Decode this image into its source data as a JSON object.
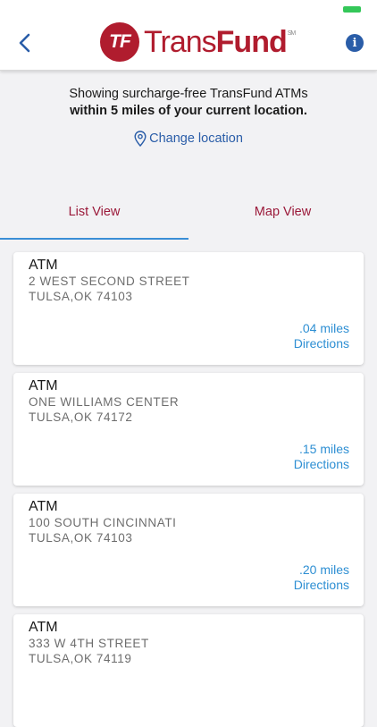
{
  "colors": {
    "brand": "#b01c2e",
    "link": "#2a5da8",
    "accent_blue": "#2e8fd3",
    "tab_text": "#9b1a3a",
    "battery": "#34c759",
    "gray_text": "#8a8a8a"
  },
  "header": {
    "logo_badge": "TF",
    "logo_trans": "Trans",
    "logo_fund": "Fund",
    "logo_mark": "SM",
    "back_icon": "chevron-left-icon",
    "info_icon": "info-icon",
    "info_glyph": "i"
  },
  "info": {
    "line1": "Showing surcharge-free TransFund ATMs",
    "line2": "within 5 miles of your current location.",
    "change_location_label": "Change location",
    "location_icon": "location-pin-icon"
  },
  "tabs": [
    {
      "label": "List View",
      "active": true
    },
    {
      "label": "Map View",
      "active": false
    }
  ],
  "atms": [
    {
      "title": "ATM",
      "address1": "2 WEST SECOND STREET",
      "address2": "TULSA,OK 74103",
      "distance": ".04 miles",
      "directions_label": "Directions"
    },
    {
      "title": "ATM",
      "address1": "ONE WILLIAMS CENTER",
      "address2": "TULSA,OK 74172",
      "distance": ".15 miles",
      "directions_label": "Directions"
    },
    {
      "title": "ATM",
      "address1": "100 SOUTH CINCINNATI",
      "address2": "TULSA,OK 74103",
      "distance": ".20 miles",
      "directions_label": "Directions"
    },
    {
      "title": "ATM",
      "address1": "333 W 4TH STREET",
      "address2": "TULSA,OK 74119",
      "distance": "",
      "directions_label": ""
    }
  ]
}
